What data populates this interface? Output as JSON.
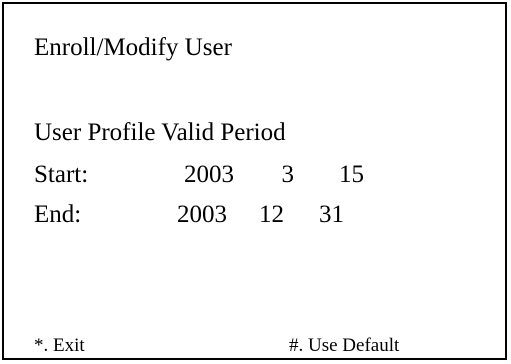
{
  "screen": {
    "title": "Enroll/Modify User",
    "section_heading": "User Profile Valid Period",
    "start": {
      "label": "Start:",
      "year": "2003",
      "month": "3",
      "day": "15"
    },
    "end": {
      "label": "End:",
      "year": "2003",
      "month": "12",
      "day": "31"
    },
    "footer": {
      "exit_label": "*. Exit",
      "default_label": "#. Use Default"
    }
  }
}
